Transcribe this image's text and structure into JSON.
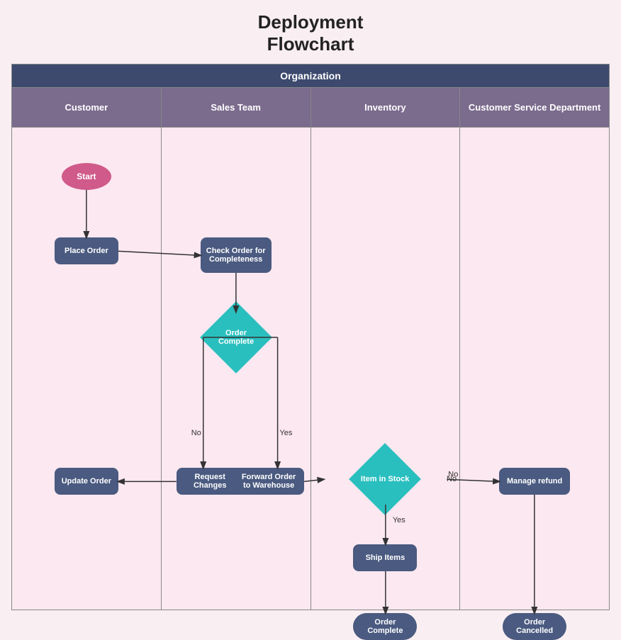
{
  "title": "Deployment\nFlowchart",
  "org_label": "Organization",
  "columns": [
    {
      "id": "customer",
      "label": "Customer"
    },
    {
      "id": "sales",
      "label": "Sales Team"
    },
    {
      "id": "inventory",
      "label": "Inventory"
    },
    {
      "id": "csd",
      "label": "Customer Service Department"
    }
  ],
  "nodes": {
    "start": "Start",
    "place_order": "Place Order",
    "check_order": "Check Order for Completeness",
    "order_complete": "Order Complete",
    "request_changes": "Request Changes",
    "forward_order": "Forward Order to Warehouse",
    "update_order": "Update Order",
    "item_in_stock": "Item in Stock",
    "ship_items": "Ship Items",
    "order_complete_end": "Order Complete",
    "manage_refund": "Manage refund",
    "order_cancelled": "Order Cancelled"
  },
  "labels": {
    "no": "No",
    "yes": "Yes"
  }
}
